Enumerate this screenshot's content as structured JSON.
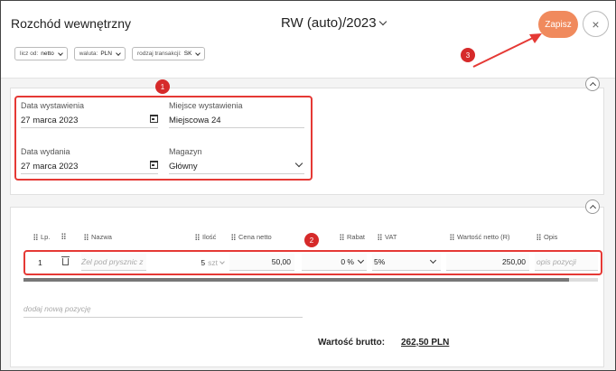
{
  "header": {
    "title": "Rozchód wewnętrzny",
    "doc_number": "RW (auto)/2023",
    "save_label": "Zapisz",
    "close_label": "×"
  },
  "filters": [
    {
      "label": "licz od:",
      "value": "netto"
    },
    {
      "label": "waluta:",
      "value": "PLN"
    },
    {
      "label": "rodzaj transakcji:",
      "value": "SK"
    }
  ],
  "annotations": {
    "b1": "1",
    "b2": "2",
    "b3": "3"
  },
  "colors": {
    "accent": "#f08a5d",
    "highlight": "#e53935"
  },
  "details": {
    "issue_date_label": "Data wystawienia",
    "issue_date": "27 marca 2023",
    "issue_place_label": "Miejsce wystawienia",
    "issue_place": "Miejscowa 24",
    "release_date_label": "Data wydania",
    "release_date": "27 marca 2023",
    "warehouse_label": "Magazyn",
    "warehouse": "Główny"
  },
  "table": {
    "headers": {
      "lp": "Lp.",
      "name": "Nazwa",
      "qty": "Ilość",
      "net_price": "Cena netto",
      "discount": "Rabat",
      "vat": "VAT",
      "net_value": "Wartość netto (R)",
      "desc": "Opis"
    },
    "row": {
      "lp": "1",
      "name": "Żel pod prysznic z",
      "qty": "5",
      "unit": "szt",
      "net_price": "50,00",
      "discount": "0 %",
      "vat": "5%",
      "net_value": "250,00",
      "desc_placeholder": "opis pozycji"
    },
    "add_position": "dodaj nową pozycję"
  },
  "totals": {
    "gross_label": "Wartość brutto:",
    "gross_value": "262,50 PLN"
  }
}
